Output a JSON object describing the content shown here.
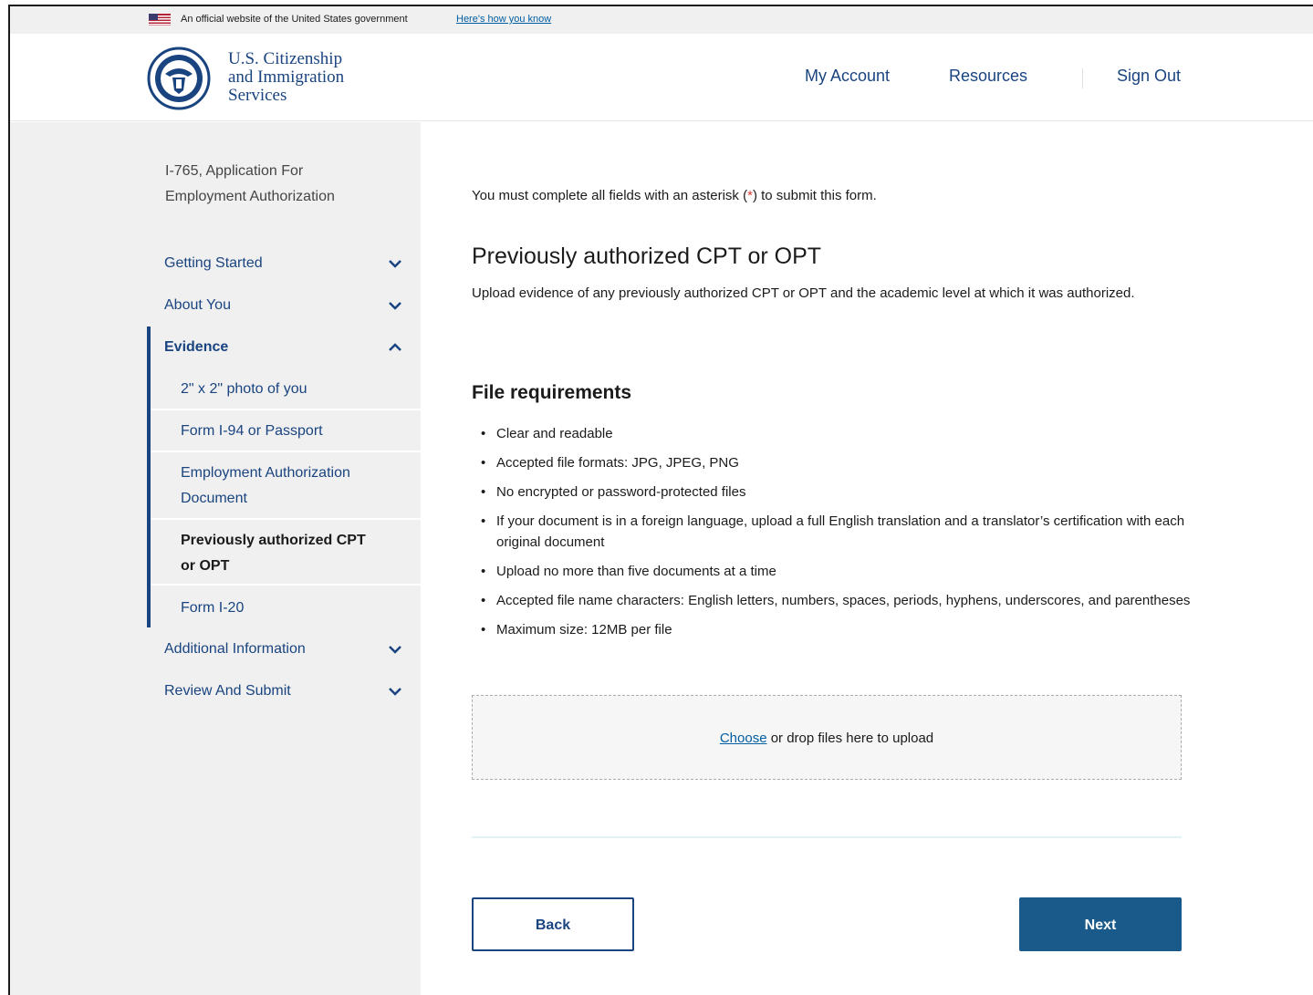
{
  "banner": {
    "text": "An official website of the United States government",
    "link": "Here's how you know"
  },
  "header": {
    "agency_line1": "U.S. Citizenship",
    "agency_line2": "and Immigration",
    "agency_line3": "Services",
    "nav": {
      "my_account": "My Account",
      "resources": "Resources",
      "sign_out": "Sign Out"
    }
  },
  "sidebar": {
    "form_title_line1": "I-765, Application For",
    "form_title_line2": "Employment Authorization",
    "sections": {
      "getting_started": "Getting Started",
      "about_you": "About You",
      "evidence": "Evidence",
      "additional_information": "Additional Information",
      "review_and_submit": "Review And Submit"
    },
    "evidence_items": {
      "photo": "2\" x 2\" photo of you",
      "i94": "Form I-94 or Passport",
      "ead_line1": "Employment Authorization",
      "ead_line2": "Document",
      "cpt_line1": "Previously authorized CPT",
      "cpt_line2": "or OPT",
      "i20": "Form I-20"
    }
  },
  "main": {
    "required_note_before": "You must complete all fields with an asterisk (",
    "required_note_asterisk": "*",
    "required_note_after": ") to submit this form.",
    "title": "Previously authorized CPT or OPT",
    "description": "Upload evidence of any previously authorized CPT or OPT and the academic level at which it was authorized.",
    "requirements_title": "File requirements",
    "requirements": [
      "Clear and readable",
      "Accepted file formats: JPG, JPEG, PNG",
      "No encrypted or password-protected files",
      "If your document is in a foreign language, upload a full English translation and a translator’s certification with each original document",
      "Upload no more than five documents at a time",
      "Accepted file name characters: English letters, numbers, spaces, periods, hyphens, underscores, and parentheses",
      "Maximum size: 12MB per file"
    ],
    "dropzone": {
      "choose": "Choose",
      "text": " or drop files here to upload"
    },
    "buttons": {
      "back": "Back",
      "next": "Next"
    }
  },
  "colors": {
    "primary": "#1a4480",
    "button": "#1a5a8a",
    "link": "#005ea2",
    "sidebar_bg": "#f0f0f0",
    "asterisk": "#d83933"
  },
  "icons": {
    "flag": "us-flag-icon",
    "seal": "dhs-seal-icon",
    "chevron_down": "chevron-down-icon",
    "chevron_up": "chevron-up-icon"
  }
}
